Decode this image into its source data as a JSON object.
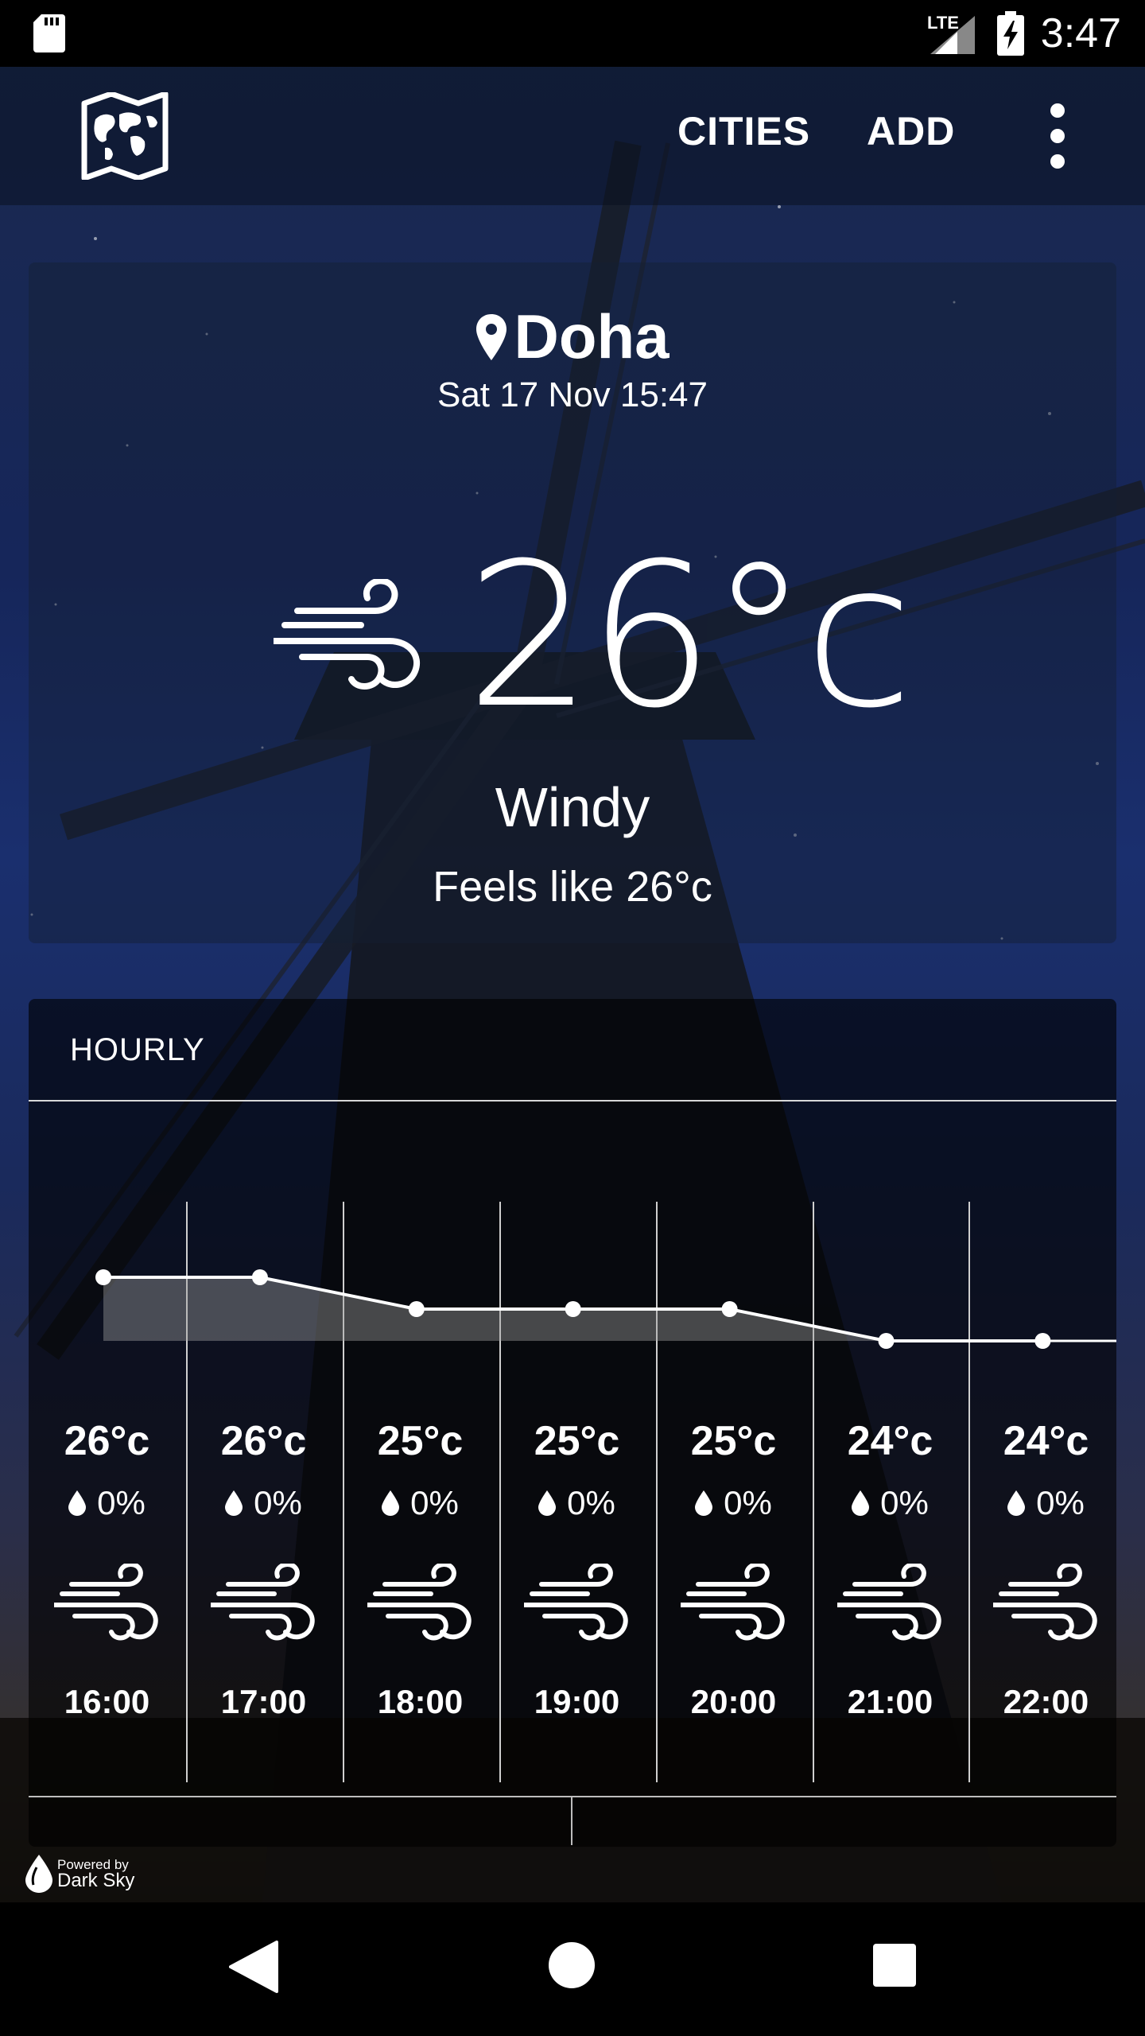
{
  "status_bar": {
    "time": "3:47",
    "network": "LTE",
    "icons": [
      "sd-card-icon",
      "signal-icon",
      "battery-charging-icon"
    ]
  },
  "app_bar": {
    "logo_icon": "world-map-icon",
    "cities_label": "CITIES",
    "add_label": "ADD",
    "more_icon": "more-vertical-icon"
  },
  "current": {
    "city": "Doha",
    "datetime": "Sat 17 Nov 15:47",
    "temperature": "26°c",
    "condition": "Windy",
    "feels_like": "Feels like 26°c",
    "icon": "wind-icon"
  },
  "hourly": {
    "title": "HOURLY",
    "items": [
      {
        "time": "16:00",
        "temp": "26°c",
        "precip": "0%",
        "icon": "wind-icon"
      },
      {
        "time": "17:00",
        "temp": "26°c",
        "precip": "0%",
        "icon": "wind-icon"
      },
      {
        "time": "18:00",
        "temp": "25°c",
        "precip": "0%",
        "icon": "wind-icon"
      },
      {
        "time": "19:00",
        "temp": "25°c",
        "precip": "0%",
        "icon": "wind-icon"
      },
      {
        "time": "20:00",
        "temp": "25°c",
        "precip": "0%",
        "icon": "wind-icon"
      },
      {
        "time": "21:00",
        "temp": "24°c",
        "precip": "0%",
        "icon": "wind-icon"
      },
      {
        "time": "22:00",
        "temp": "24°c",
        "precip": "0%",
        "icon": "wind-icon"
      }
    ],
    "temperature_values": [
      26,
      26,
      25,
      25,
      25,
      24,
      24
    ]
  },
  "footer": {
    "powered_by": "Powered by",
    "brand": "Dark Sky"
  },
  "nav_bar": {
    "icons": [
      "back-icon",
      "home-icon",
      "recents-icon"
    ]
  }
}
